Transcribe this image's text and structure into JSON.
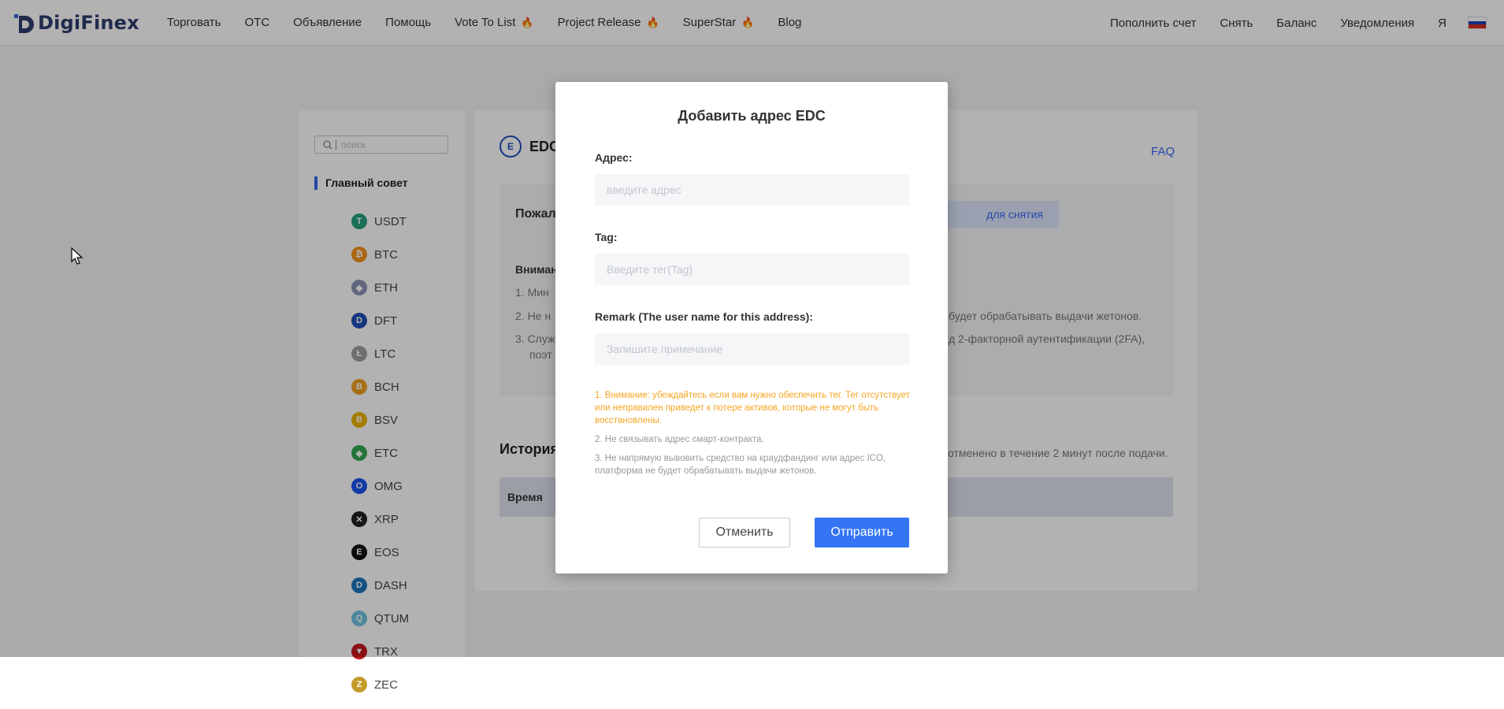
{
  "header": {
    "logo_text": "DigiFinex",
    "nav": [
      {
        "label": "Торговать",
        "hot": false
      },
      {
        "label": "OTC",
        "hot": false
      },
      {
        "label": "Объявление",
        "hot": false
      },
      {
        "label": "Помощь",
        "hot": false
      },
      {
        "label": "Vote To List",
        "hot": true
      },
      {
        "label": "Project Release",
        "hot": true
      },
      {
        "label": "SuperStar",
        "hot": true
      },
      {
        "label": "Blog",
        "hot": false
      }
    ],
    "right_nav": [
      "Пополнить счет",
      "Снять",
      "Баланс",
      "Уведомления",
      "Я"
    ],
    "hot_icon": "fire-icon",
    "language_flag": "ru-flag-icon"
  },
  "sidebar": {
    "search_placeholder": "поиск",
    "section_title": "Главный совет",
    "coins": [
      {
        "symbol": "USDT",
        "color": "#26a17b",
        "glyph": "T"
      },
      {
        "symbol": "BTC",
        "color": "#f7931a",
        "glyph": "₿"
      },
      {
        "symbol": "ETH",
        "color": "#8a92b2",
        "glyph": "◆"
      },
      {
        "symbol": "DFT",
        "color": "#1e4fb8",
        "glyph": "D"
      },
      {
        "symbol": "LTC",
        "color": "#a0a0a0",
        "glyph": "Ł"
      },
      {
        "symbol": "BCH",
        "color": "#f0a020",
        "glyph": "B"
      },
      {
        "symbol": "BSV",
        "color": "#eab300",
        "glyph": "B"
      },
      {
        "symbol": "ETC",
        "color": "#33a853",
        "glyph": "◆"
      },
      {
        "symbol": "OMG",
        "color": "#1a53f0",
        "glyph": "O"
      },
      {
        "symbol": "XRP",
        "color": "#222222",
        "glyph": "✕"
      },
      {
        "symbol": "EOS",
        "color": "#111111",
        "glyph": "E"
      },
      {
        "symbol": "DASH",
        "color": "#1c75bc",
        "glyph": "D"
      },
      {
        "symbol": "QTUM",
        "color": "#6fc3e0",
        "glyph": "Q"
      },
      {
        "symbol": "TRX",
        "color": "#c4171b",
        "glyph": "▼"
      },
      {
        "symbol": "ZEC",
        "color": "#c49b2a",
        "glyph": "Z"
      }
    ]
  },
  "main": {
    "title": "EDC",
    "faq": "FAQ",
    "ask_text": "Пожал",
    "withdraw_button": "для снятия",
    "attention": "Вниман",
    "notes_left": [
      "1. Мин",
      "2. Не н",
      "3. Служ",
      "поэт"
    ],
    "notes_right": [
      "будет обрабатывать выдачи жетонов.",
      "д 2-факторной аутентификации (2FA),"
    ],
    "history_title": "История",
    "history_note": "отменено в течение 2 минут после подачи.",
    "table_header": "Время"
  },
  "modal": {
    "title": "Добавить адрес EDC",
    "address_label": "Адрес:",
    "address_placeholder": "введите адрес",
    "tag_label": "Tag:",
    "tag_placeholder": "Введите тег(Tag)",
    "remark_label": "Remark (The user name for this address):",
    "remark_placeholder": "Запишите примечание",
    "warning_1": "1. Внимание: убеждайтесь если вам нужно обеспечить тег. Тег отсутствует или неправилен приведет к потере активов, которые не могут быть восстановлены.",
    "warning_2": "2. Не связывать адрес смарт-контракта.",
    "warning_3": "3. Не напрямую вывовить средство на краудфандинг или адрес ICO, платформа не будет обрабатывать выдачи жетонов.",
    "cancel": "Отменить",
    "submit": "Отправить"
  },
  "colors": {
    "accent": "#3475f5",
    "warning": "#f5a623",
    "brand": "#2f3d6e"
  }
}
